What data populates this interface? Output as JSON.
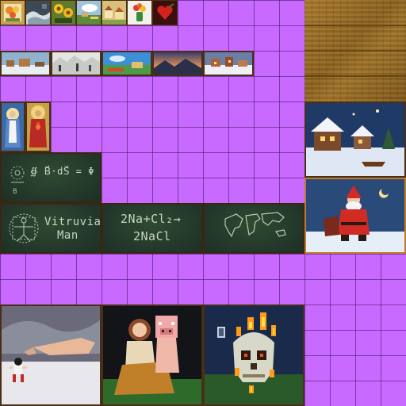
{
  "atlas": {
    "background_color": "#c869ff",
    "grid_color": "#5a2a86",
    "frame_color": "#4a2e16"
  },
  "paintings_small": [
    {
      "subject": "flowers-still-life"
    },
    {
      "subject": "storm-sea"
    },
    {
      "subject": "sunflowers"
    },
    {
      "subject": "landscape-cloud"
    },
    {
      "subject": "village-scene"
    },
    {
      "subject": "flowers-vase"
    },
    {
      "subject": "heart-rose"
    }
  ],
  "paintings_wide": [
    {
      "subject": "winter-village"
    },
    {
      "subject": "snowy-landscape"
    },
    {
      "subject": "blue-sky-landscape"
    },
    {
      "subject": "mountain-sunset"
    },
    {
      "subject": "winter-town"
    }
  ],
  "religious_icons": [
    {
      "subject": "mary"
    },
    {
      "subject": "jesus"
    }
  ],
  "chalkboards": {
    "vitruvian": {
      "line1": "Vitruvian",
      "line2": "Man"
    },
    "chemistry": {
      "line1": "2Na+Cl₂→",
      "line2": "2NaCl"
    },
    "formula": {
      "text": "∯ B⃗·dS⃗ = Φ"
    },
    "world_map": {
      "subject": "world-map"
    }
  },
  "christmas": [
    {
      "subject": "christmas-village-night"
    },
    {
      "subject": "santa-claus"
    }
  ],
  "large_paintings": [
    {
      "subject": "creation-of-adam-parody"
    },
    {
      "subject": "girl-with-pig-mask"
    },
    {
      "subject": "burning-skull"
    }
  ]
}
